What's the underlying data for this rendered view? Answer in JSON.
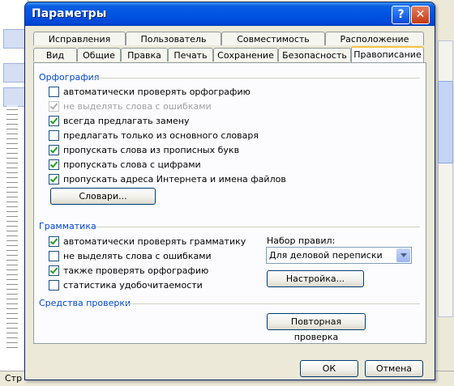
{
  "window": {
    "title": "Параметры",
    "help_label": "?",
    "close_label": "✕"
  },
  "tabs_row1": [
    "Исправления",
    "Пользователь",
    "Совместимость",
    "Расположение"
  ],
  "tabs_row2": [
    "Вид",
    "Общие",
    "Правка",
    "Печать",
    "Сохранение",
    "Безопасность",
    "Правописание"
  ],
  "active_tab": "Правописание",
  "spelling": {
    "section_title": "Орфография",
    "options": [
      {
        "label": "автоматически проверять орфографию",
        "checked": false,
        "disabled": false
      },
      {
        "label": "не выделять слова с ошибками",
        "checked": true,
        "disabled": true
      },
      {
        "label": "всегда предлагать замену",
        "checked": true,
        "disabled": false
      },
      {
        "label": "предлагать только из основного словаря",
        "checked": false,
        "disabled": false
      },
      {
        "label": "пропускать слова из прописных букв",
        "checked": true,
        "disabled": false
      },
      {
        "label": "пропускать слова с цифрами",
        "checked": true,
        "disabled": false
      },
      {
        "label": "пропускать адреса Интернета и имена файлов",
        "checked": true,
        "disabled": false
      }
    ],
    "dictionaries_button": "Словари..."
  },
  "grammar": {
    "section_title": "Грамматика",
    "options": [
      {
        "label": "автоматически проверять грамматику",
        "checked": true
      },
      {
        "label": "не выделять слова с ошибками",
        "checked": false
      },
      {
        "label": "также проверять орфографию",
        "checked": true
      },
      {
        "label": "статистика удобочитаемости",
        "checked": false
      }
    ],
    "ruleset_label": "Набор правил:",
    "ruleset_value": "Для деловой переписки",
    "settings_button": "Настройка..."
  },
  "proofing": {
    "section_title": "Средства проверки",
    "recheck_button": "Повторная проверка"
  },
  "footer": {
    "ok": "ОК",
    "cancel": "Отмена"
  },
  "background": {
    "status_text": "Стр"
  },
  "colors": {
    "title_bar": "#0054e3",
    "section_text": "#0046d5",
    "tab_highlight": "#f7c340",
    "check": "#21a121"
  }
}
